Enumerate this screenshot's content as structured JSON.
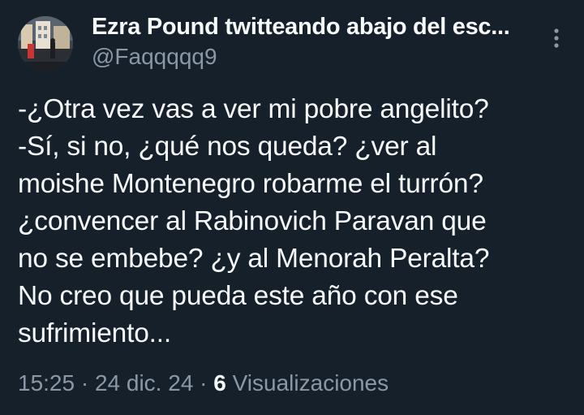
{
  "colors": {
    "background": "#15202b",
    "primary_text": "#f7f9f9",
    "secondary_text": "#8b98a5"
  },
  "author": {
    "display_name": "Ezra Pound twitteando abajo del esc...",
    "handle": "@Faqqqqq9",
    "avatar_icon": "profile-photo"
  },
  "menu": {
    "icon": "more-vertical-icon"
  },
  "tweet": {
    "lines": [
      "-¿Otra vez vas a ver mi pobre angelito?",
      "-Sí, si no, ¿qué nos queda? ¿ver al",
      "moishe Montenegro robarme el turrón?",
      "¿convencer al Rabinovich Paravan que",
      "no se embebe? ¿y al Menorah Peralta?",
      "No creo que pueda este año con ese",
      "sufrimiento..."
    ]
  },
  "meta": {
    "time": "15:25",
    "separator_1": "·",
    "date": "24 dic. 24",
    "separator_2": "·",
    "views_count": "6",
    "views_label": "Visualizaciones"
  }
}
